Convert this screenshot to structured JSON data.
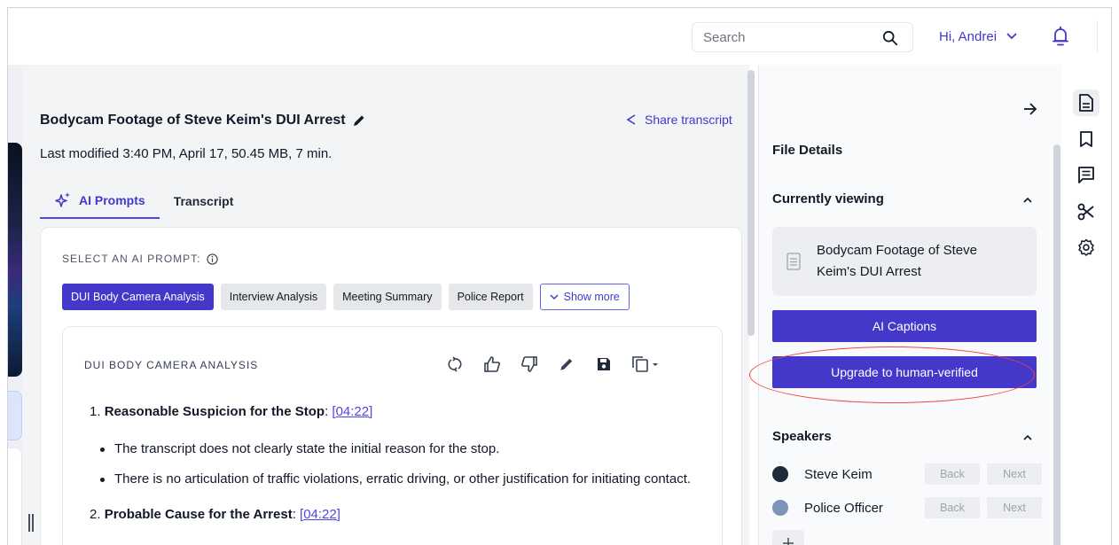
{
  "header": {
    "search_placeholder": "Search",
    "greeting": "Hi, Andrei",
    "icons": [
      "search-icon",
      "chevron-down-icon",
      "bell-icon"
    ]
  },
  "file": {
    "title": "Bodycam Footage of Steve Keim's DUI Arrest",
    "meta": "Last modified 3:40 PM, April 17, 50.45 MB, 7 min.",
    "share_label": "Share transcript"
  },
  "tabs": [
    {
      "label": "AI Prompts",
      "active": true
    },
    {
      "label": "Transcript",
      "active": false
    }
  ],
  "prompts": {
    "select_label": "SELECT AN AI PROMPT:",
    "chips": [
      "DUI Body Camera Analysis",
      "Interview Analysis",
      "Meeting Summary",
      "Police Report"
    ],
    "show_more": "Show more"
  },
  "analysis": {
    "label": "DUI BODY CAMERA ANALYSIS",
    "items": [
      {
        "num": "1.",
        "heading": "Reasonable Suspicion for the Stop",
        "timestamp": "[04:22]",
        "bullets": [
          "The transcript does not clearly state the initial reason for the stop.",
          "There is no articulation of traffic violations, erratic driving, or other justification for initiating contact."
        ]
      },
      {
        "num": "2.",
        "heading": "Probable Cause for the Arrest",
        "timestamp": "[04:22]",
        "bullets": []
      }
    ]
  },
  "panel": {
    "heading": "File Details",
    "currently_viewing": "Currently viewing",
    "file_name": "Bodycam Footage of Steve Keim's DUI Arrest",
    "ai_captions": "AI Captions",
    "upgrade": "Upgrade to human-verified",
    "speakers_heading": "Speakers",
    "speakers": [
      {
        "name": "Steve Keim",
        "color": "#1f2937"
      },
      {
        "name": "Police Officer",
        "color": "#7b94b8"
      }
    ],
    "back_label": "Back",
    "next_label": "Next",
    "add_label": "+"
  },
  "colors": {
    "accent": "#4338ca",
    "highlight": "#ef4444"
  }
}
